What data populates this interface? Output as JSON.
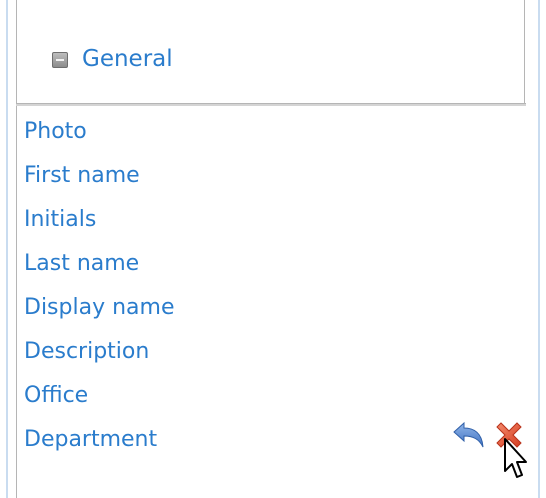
{
  "section": {
    "label": "General",
    "toggle_icon": "collapse-icon"
  },
  "fields": [
    {
      "label": "Photo"
    },
    {
      "label": "First name"
    },
    {
      "label": "Initials"
    },
    {
      "label": "Last name"
    },
    {
      "label": "Display name"
    },
    {
      "label": "Description"
    },
    {
      "label": "Office"
    },
    {
      "label": "Department"
    }
  ],
  "actions": {
    "undo_icon": "undo-icon",
    "remove_icon": "remove-icon"
  },
  "colors": {
    "link": "#2a7ccc",
    "remove": "#e8583c",
    "undo": "#5b8fd6",
    "frame": "#c9dcf0"
  }
}
